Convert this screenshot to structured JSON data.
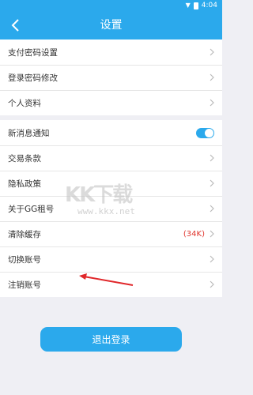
{
  "status_bar": {
    "time": "4:04",
    "wifi_icon": "wifi-icon",
    "battery_icon": "battery-icon"
  },
  "header": {
    "title": "设置",
    "back_icon": "chevron-left-icon",
    "background": "#2ba9ec"
  },
  "group1": {
    "items": [
      {
        "label": "支付密码设置"
      },
      {
        "label": "登录密码修改"
      },
      {
        "label": "个人资料"
      }
    ]
  },
  "group2": {
    "notify_label": "新消息通知",
    "notify_enabled": true,
    "items": [
      {
        "label": "交易条款"
      },
      {
        "label": "隐私政策"
      },
      {
        "label": "关于GG租号"
      }
    ],
    "cache_label": "清除缓存",
    "cache_value": "(34K)",
    "switch_label": "切换账号",
    "cancel_label": "注销账号"
  },
  "watermark": {
    "logo_text": "KK下载",
    "url": "www.kkx.net"
  },
  "logout_button": {
    "label": "退出登录"
  },
  "colors": {
    "accent": "#2ba9ec",
    "page_bg": "#efeff4",
    "cache_red": "#e0372f",
    "arrow_red": "#e0272a"
  }
}
